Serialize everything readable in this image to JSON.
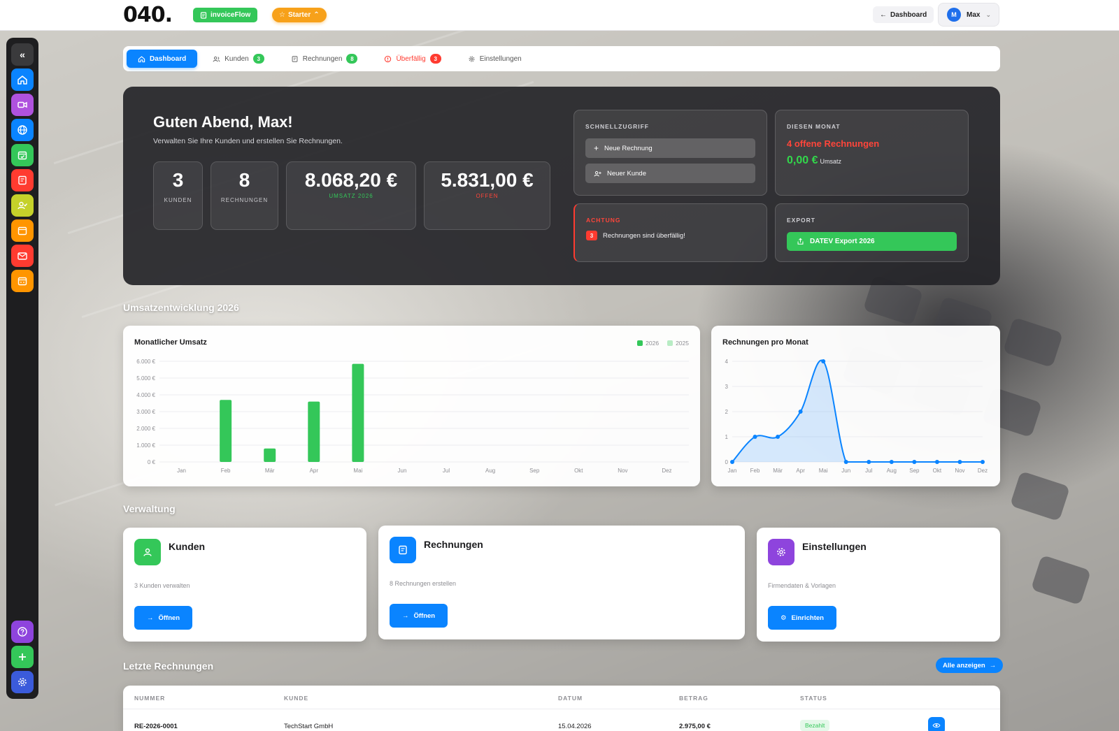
{
  "header": {
    "logo": "040.",
    "app_name": "invoiceFlow",
    "plan": "Starter",
    "back_label": "Dashboard",
    "user_initial": "M",
    "user_name": "Max"
  },
  "tabs": [
    {
      "label": "Dashboard"
    },
    {
      "label": "Kunden",
      "badge": "3"
    },
    {
      "label": "Rechnungen",
      "badge": "8"
    },
    {
      "label": "Überfällig",
      "badge": "3"
    },
    {
      "label": "Einstellungen"
    }
  ],
  "hero": {
    "greeting": "Guten Abend, Max!",
    "subtitle": "Verwalten Sie Ihre Kunden und erstellen Sie Rechnungen.",
    "stats": [
      {
        "value": "3",
        "label": "KUNDEN"
      },
      {
        "value": "8",
        "label": "RECHNUNGEN"
      },
      {
        "value": "8.068,20 €",
        "label": "UMSATZ 2026"
      },
      {
        "value": "5.831,00 €",
        "label": "OFFEN"
      }
    ],
    "quick": {
      "caption": "SCHNELLZUGRIFF",
      "new_invoice": "Neue Rechnung",
      "new_customer": "Neuer Kunde"
    },
    "month": {
      "caption": "DIESEN MONAT",
      "open": "4 offene Rechnungen",
      "revenue": "0,00 €",
      "revenue_label": "Umsatz"
    },
    "alert": {
      "caption": "ACHTUNG",
      "count": "3",
      "text": "Rechnungen sind überfällig!"
    },
    "export": {
      "caption": "EXPORT",
      "button": "DATEV Export 2026"
    }
  },
  "sections": {
    "revenue": "Umsatzentwicklung 2026",
    "management": "Verwaltung",
    "recent": "Letzte Rechnungen"
  },
  "colors": {
    "accent": "#0a84ff",
    "success": "#34c759",
    "danger": "#ff3b30",
    "warning": "#f7a11a",
    "purple": "#8e44dd"
  },
  "chart_data": [
    {
      "type": "bar",
      "title": "Monatlicher Umsatz",
      "categories": [
        "Jan",
        "Feb",
        "Mär",
        "Apr",
        "Mai",
        "Jun",
        "Jul",
        "Aug",
        "Sep",
        "Okt",
        "Nov",
        "Dez"
      ],
      "series": [
        {
          "name": "2026",
          "color": "#34c759",
          "values": [
            0,
            3700,
            800,
            3600,
            5850,
            0,
            0,
            0,
            0,
            0,
            0,
            0
          ]
        },
        {
          "name": "2025",
          "color": "#b8ecc4",
          "values": [
            0,
            0,
            0,
            0,
            0,
            0,
            0,
            0,
            0,
            0,
            0,
            0
          ]
        }
      ],
      "y_ticks": [
        "0 €",
        "1.000 €",
        "2.000 €",
        "3.000 €",
        "4.000 €",
        "5.000 €",
        "6.000 €"
      ],
      "ylim": [
        0,
        6000
      ],
      "grid": true,
      "legend": "top-right"
    },
    {
      "type": "area",
      "title": "Rechnungen pro Monat",
      "categories": [
        "Jan",
        "Feb",
        "Mär",
        "Apr",
        "Mai",
        "Jun",
        "Jul",
        "Aug",
        "Sep",
        "Okt",
        "Nov",
        "Dez"
      ],
      "values": [
        0,
        1,
        1,
        2,
        4,
        0,
        0,
        0,
        0,
        0,
        0,
        0
      ],
      "y_ticks": [
        "0",
        "1",
        "2",
        "3",
        "4"
      ],
      "ylim": [
        0,
        4
      ],
      "color": "#0a84ff",
      "grid": true
    }
  ],
  "management": [
    {
      "title": "Kunden",
      "desc": "3 Kunden verwalten",
      "button": "Öffnen",
      "color": "#34c759"
    },
    {
      "title": "Rechnungen",
      "desc": "8 Rechnungen erstellen",
      "button": "Öffnen",
      "color": "#0a84ff"
    },
    {
      "title": "Einstellungen",
      "desc": "Firmendaten & Vorlagen",
      "button": "Einrichten",
      "color": "#8e44dd"
    }
  ],
  "recent": {
    "show_all": "Alle anzeigen",
    "columns": [
      "NUMMER",
      "KUNDE",
      "DATUM",
      "BETRAG",
      "STATUS"
    ],
    "rows": [
      {
        "number": "RE-2026-0001",
        "customer": "TechStart GmbH",
        "date": "15.04.2026",
        "amount": "2.975,00 €",
        "status": "Bezahlt"
      }
    ]
  }
}
